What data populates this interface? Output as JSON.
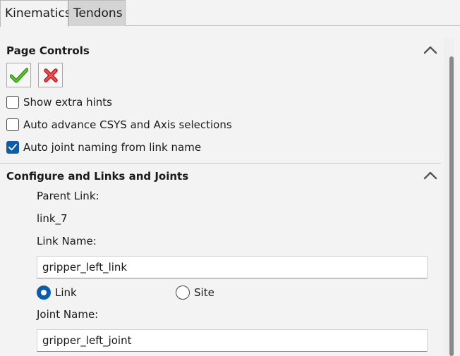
{
  "tabs": [
    {
      "label": "Kinematics",
      "active": true
    },
    {
      "label": "Tendons",
      "active": false
    }
  ],
  "page_controls": {
    "title": "Page Controls",
    "ok_icon": "checkmark-icon",
    "cancel_icon": "close-icon",
    "ok_color": "#3c9a1b",
    "cancel_color": "#d93a3a",
    "options": [
      {
        "label": "Show extra hints",
        "checked": false
      },
      {
        "label": "Auto advance CSYS and Axis selections",
        "checked": false
      },
      {
        "label": "Auto joint naming from link name",
        "checked": true
      }
    ]
  },
  "configure": {
    "title": "Configure and Links and Joints",
    "parent_link_label": "Parent Link:",
    "parent_link_value": "link_7",
    "link_name_label": "Link Name:",
    "link_name_value": "gripper_left_link",
    "type_options": [
      {
        "label": "Link",
        "selected": true
      },
      {
        "label": "Site",
        "selected": false
      }
    ],
    "joint_name_label": "Joint Name:",
    "joint_name_value": "gripper_left_joint"
  },
  "colors": {
    "accent": "#0b5cad"
  }
}
